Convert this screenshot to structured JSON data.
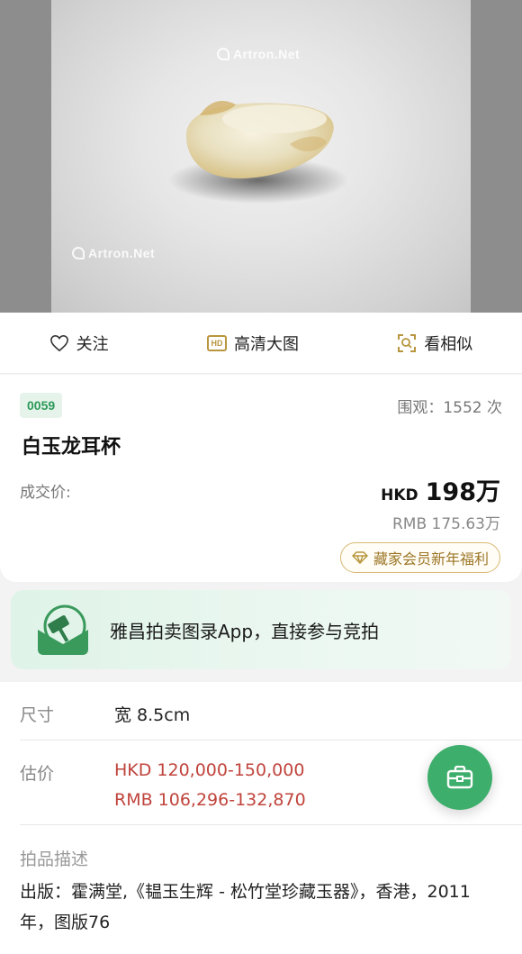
{
  "hero": {
    "watermark_top": "Artron.Net",
    "watermark_bottom": "Artron.Net"
  },
  "actions": {
    "follow": "关注",
    "hd_badge": "HD",
    "hd_image": "高清大图",
    "similar": "看相似"
  },
  "lot": {
    "number": "0059",
    "views": "围观：1552 次",
    "title": "白玉龙耳杯",
    "deal_label": "成交价:",
    "price_currency": "HKD",
    "price_value": "198万",
    "price_rmb": "RMB 175.63万",
    "member_promo": "藏家会员新年福利"
  },
  "banner": {
    "text": "雅昌拍卖图录App，直接参与竞拍"
  },
  "details": {
    "size_label": "尺寸",
    "size_value": "宽 8.5cm",
    "estimate_label": "估价",
    "estimate_hkd": "HKD  120,000-150,000",
    "estimate_rmb": "RMB 106,296-132,870",
    "desc_label": "拍品描述",
    "desc_text": "出版：霍满堂,《韫玉生辉 - 松竹堂珍藏玉器》，香港，2011年，图版76"
  },
  "colors": {
    "brand_green": "#3dae6b",
    "estimate_red": "#c0443c",
    "gold": "#b8963e"
  },
  "icons": [
    "heart-icon",
    "hd-icon",
    "scan-icon",
    "diamond-icon",
    "app-logo-icon",
    "briefcase-icon"
  ]
}
